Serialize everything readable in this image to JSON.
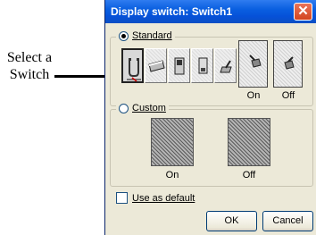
{
  "annotation": {
    "line1": "Select a",
    "line2": "Switch"
  },
  "dialog": {
    "title": "Display switch: Switch1",
    "close_glyph": "✕",
    "standard_label": "Standard",
    "standard_selected": true,
    "custom_label": "Custom",
    "custom_selected": false,
    "on_label": "On",
    "off_label": "Off",
    "custom_on_label": "On",
    "custom_off_label": "Off",
    "use_default_label": "Use as default",
    "use_default_checked": false,
    "ok_label": "OK",
    "cancel_label": "Cancel",
    "switch_styles": [
      "toggle-magnet-icon",
      "rocker-flat-icon",
      "slide-vertical-icon",
      "toggle-bat-icon",
      "lever-icon"
    ],
    "selected_switch_index": 0
  }
}
